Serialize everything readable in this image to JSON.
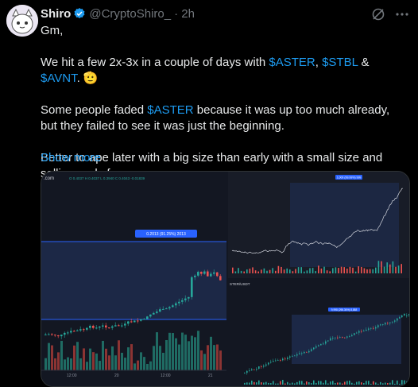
{
  "author": {
    "name": "Shiro",
    "handle": "@CryptoShiro_",
    "time": "· 2h"
  },
  "tweet": {
    "line1": "Gm,",
    "p2_a": "We hit a few 2x-3x in a couple of days with ",
    "p2_t1": "$ASTER",
    "p2_b": ", ",
    "p2_t2": "$STBL",
    "p2_c": " & ",
    "p2_t3": "$AVNT",
    "p2_d": ". 🫡",
    "p3_a": "Some people faded ",
    "p3_t1": "$ASTER",
    "p3_b": " because it was up too much already, but they failed to see it was just the beginning.",
    "p4": "Better to ape later with a big size than early with a small size and selling early for",
    "show_more": "Show more"
  },
  "media": {
    "left_chart": {
      "pair_label": ".com",
      "range_label": "0.2013 (91.25%) 2013",
      "x_ticks": [
        "12:00",
        "20",
        "12:00",
        "21"
      ]
    },
    "top_right_chart": {
      "label": "1,000 (99.99%) 999"
    },
    "bottom_right_chart": {
      "pair": "STER/USDT",
      "label": "9,998 (298.36%) 8,888"
    }
  },
  "colors": {
    "accent": "#1d9bf0",
    "bull": "#26a69a",
    "bear": "#ef5350",
    "text": "#e7e9ea",
    "muted": "#71767b"
  }
}
